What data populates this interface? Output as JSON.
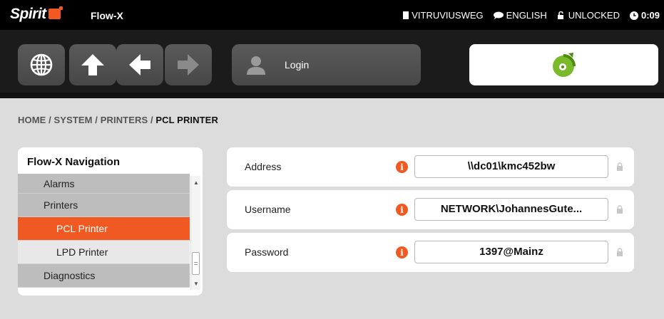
{
  "app": {
    "logo_text": "Spirit",
    "name": "Flow-X"
  },
  "status": {
    "location": "VITRUVIUSWEG",
    "language": "ENGLISH",
    "lock_state": "UNLOCKED",
    "time": "0:09"
  },
  "toolbar": {
    "login_label": "Login"
  },
  "breadcrumb": {
    "path": "HOME / SYSTEM / PRINTERS / ",
    "current": "PCL PRINTER"
  },
  "nav": {
    "title": "Flow-X Navigation",
    "items": [
      {
        "label": "Alarms"
      },
      {
        "label": "Printers"
      },
      {
        "label": "PCL Printer"
      },
      {
        "label": "LPD Printer"
      },
      {
        "label": "Diagnostics"
      }
    ]
  },
  "fields": [
    {
      "label": "Address",
      "value": "\\\\dc01\\kmc452bw"
    },
    {
      "label": "Username",
      "value": "NETWORK\\JohannesGute..."
    },
    {
      "label": "Password",
      "value": "1397@Mainz"
    }
  ],
  "colors": {
    "accent": "#f05a22",
    "brand_green": "#7ab929",
    "topbar": "#000000"
  }
}
